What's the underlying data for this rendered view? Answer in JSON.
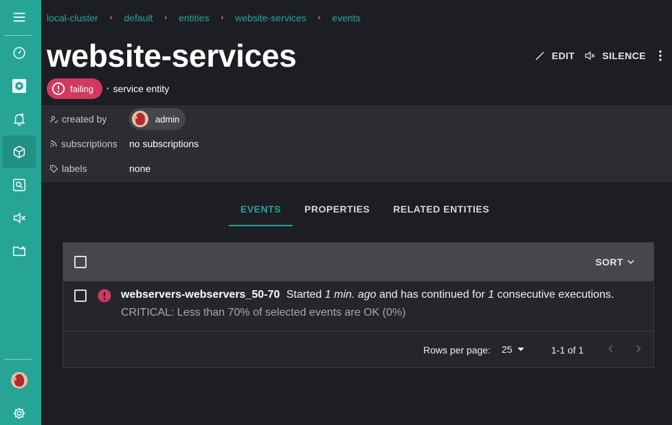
{
  "breadcrumb": [
    {
      "label": "local-cluster"
    },
    {
      "label": "default"
    },
    {
      "label": "entities"
    },
    {
      "label": "website-services"
    },
    {
      "label": "events"
    }
  ],
  "breadcrumb_separator": "›",
  "entity": {
    "name": "website-services",
    "status": "failing",
    "entity_class": "service entity"
  },
  "actions": {
    "edit": "EDIT",
    "silence": "SILENCE"
  },
  "metadata": {
    "created_by_label": "created by",
    "created_by": "admin",
    "subscriptions_label": "subscriptions",
    "subscriptions": "no subscriptions",
    "labels_label": "labels",
    "labels": "none"
  },
  "tabs": [
    {
      "label": "EVENTS",
      "active": true
    },
    {
      "label": "PROPERTIES",
      "active": false
    },
    {
      "label": "RELATED ENTITIES",
      "active": false
    }
  ],
  "events_list": {
    "sort_label": "SORT",
    "rows": [
      {
        "check": "webservers-webservers_50-70",
        "started": "Started",
        "age": "1 min. ago",
        "continued": "and has continued for",
        "count": "1",
        "executions": "consecutive executions.",
        "output": "CRITICAL: Less than 70% of selected events are OK (0%)",
        "status": "critical"
      }
    ],
    "rows_per_page_label": "Rows per page:",
    "rows_per_page": "25",
    "range": "1-1 of 1"
  },
  "sidebar": {
    "items": [
      "menu-icon",
      "dashboard-icon",
      "hexagon-icon",
      "bell-icon",
      "entities-icon",
      "search-icon",
      "silence-icon",
      "folder-icon"
    ],
    "active": "entities-icon"
  },
  "colors": {
    "accent": "#26a596",
    "critical": "#d3395f",
    "background": "#1d1e24"
  }
}
